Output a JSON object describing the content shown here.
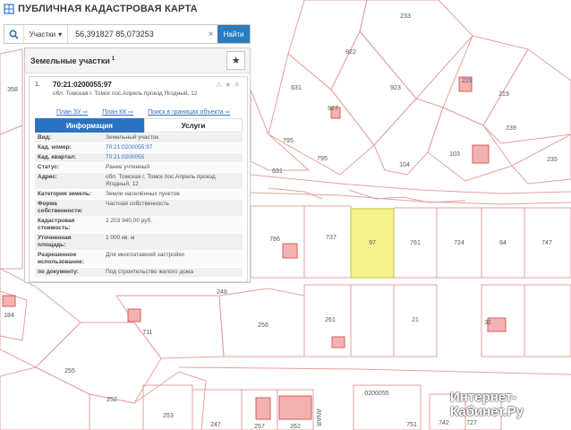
{
  "app": {
    "title": "ПУБЛИЧНАЯ КАДАСТРОВАЯ КАРТА"
  },
  "search": {
    "type_label": "Участки",
    "value": "56,391827 85,073253",
    "clear": "×",
    "find_label": "Найти"
  },
  "panel": {
    "title": "Земельные участки",
    "count": "1",
    "item": {
      "index": "1.",
      "cad_number": "70:21:0200055:97",
      "address": "обл. Томская г. Томск пос.Апрель проезд Ягодный, 12",
      "links": [
        "План ЗУ",
        "План КК",
        "Поиск в границах объекта"
      ],
      "tabs": [
        "Информация",
        "Услуги"
      ],
      "rows": [
        {
          "k": "Вид:",
          "v": "Земельный участок",
          "link": false
        },
        {
          "k": "Кад. номер:",
          "v": "70:21:0200055:97",
          "link": true
        },
        {
          "k": "Кад. квартал:",
          "v": "70:21:0200055",
          "link": true
        },
        {
          "k": "Статус:",
          "v": "Ранее учтенный",
          "link": false
        },
        {
          "k": "Адрес:",
          "v": "обл. Томская г. Томск пос.Апрель проезд Ягодный, 12",
          "link": false
        },
        {
          "k": "Категория земель:",
          "v": "Земли населённых пунктов",
          "link": false
        },
        {
          "k": "Форма собственности:",
          "v": "Частная собственность",
          "link": false
        },
        {
          "k": "Кадастровая стоимость:",
          "v": "1 203 940,00 руб.",
          "link": false
        },
        {
          "k": "Уточненная площадь:",
          "v": "1 000 кв. м",
          "link": false
        },
        {
          "k": "Разрешенное использование:",
          "v": "Для многоэтажной застройки",
          "link": false
        },
        {
          "k": "по документу:",
          "v": "Под строительство жилого дома",
          "link": false
        }
      ]
    }
  },
  "map": {
    "labels": [
      "233",
      "922",
      "229",
      "219",
      "631",
      "923",
      "927",
      "239",
      "358",
      "795",
      "795",
      "104",
      "103",
      "235",
      "631",
      "786",
      "737",
      "97",
      "761",
      "724",
      "84",
      "747",
      "248",
      "184",
      "256",
      "261",
      "21",
      "31",
      "711",
      "255",
      "252",
      "253",
      "247",
      "257",
      "262",
      "0200055",
      "751",
      "742",
      "727",
      "ANAЯ"
    ]
  },
  "watermark": [
    "Интернет-",
    "Кабинет.Ру"
  ],
  "colors": {
    "accent": "#2b73c0",
    "parcel_line": "#e08a8a",
    "selected_parcel": "#f6f28a",
    "building": "#e46a6a"
  }
}
